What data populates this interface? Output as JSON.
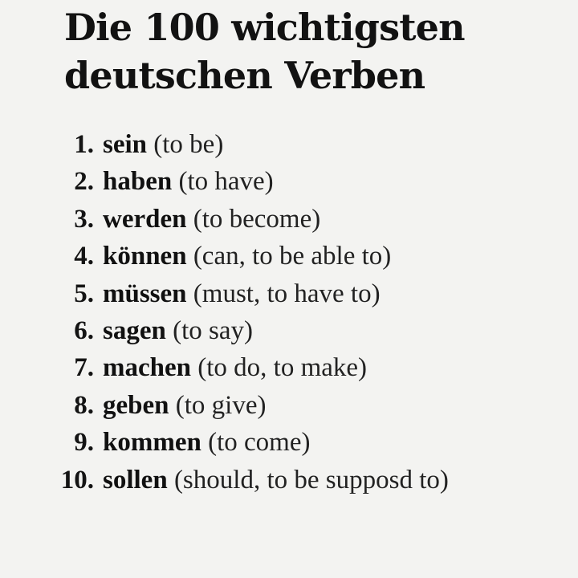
{
  "title": {
    "line1": "Die 100 wichtigsten",
    "line2": "deutschen Verben"
  },
  "verbs": [
    {
      "number": "1.",
      "german": "sein",
      "english": "(to be)"
    },
    {
      "number": "2.",
      "german": "haben",
      "english": "(to have)"
    },
    {
      "number": "3.",
      "german": "werden",
      "english": "(to become)"
    },
    {
      "number": "4.",
      "german": "können",
      "english": "(can, to be able to)"
    },
    {
      "number": "5.",
      "german": "müssen",
      "english": "(must, to have to)"
    },
    {
      "number": "6.",
      "german": "sagen",
      "english": "(to say)"
    },
    {
      "number": "7.",
      "german": "machen",
      "english": "(to do, to make)"
    },
    {
      "number": "8.",
      "german": "geben",
      "english": "(to give)"
    },
    {
      "number": "9.",
      "german": "kommen",
      "english": "(to come)"
    },
    {
      "number": "10.",
      "german": "sollen",
      "english": "(should, to be supposd to)"
    }
  ]
}
